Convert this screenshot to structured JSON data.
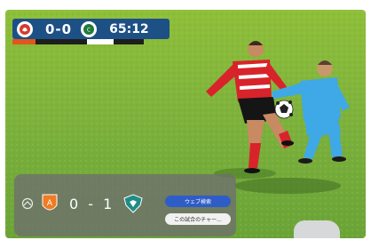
{
  "scoreboard": {
    "score": "0-0",
    "clock": "65:12",
    "home_logo_icon": "red-club-crest-icon",
    "away_logo_icon": "green-club-crest-icon",
    "colors": {
      "bar_bg": "#1e5aa8",
      "home_accent": "#e0561c",
      "away_accent": "#ffffff"
    }
  },
  "card": {
    "sport_icon": "soccer-icon",
    "home_logo_icon": "orange-club-crest-icon",
    "away_logo_icon": "teal-club-crest-icon",
    "score": "0 - 1",
    "buttons": {
      "web_search_label": "ウェブ検索",
      "more_label": "この試合のチャー..."
    }
  }
}
